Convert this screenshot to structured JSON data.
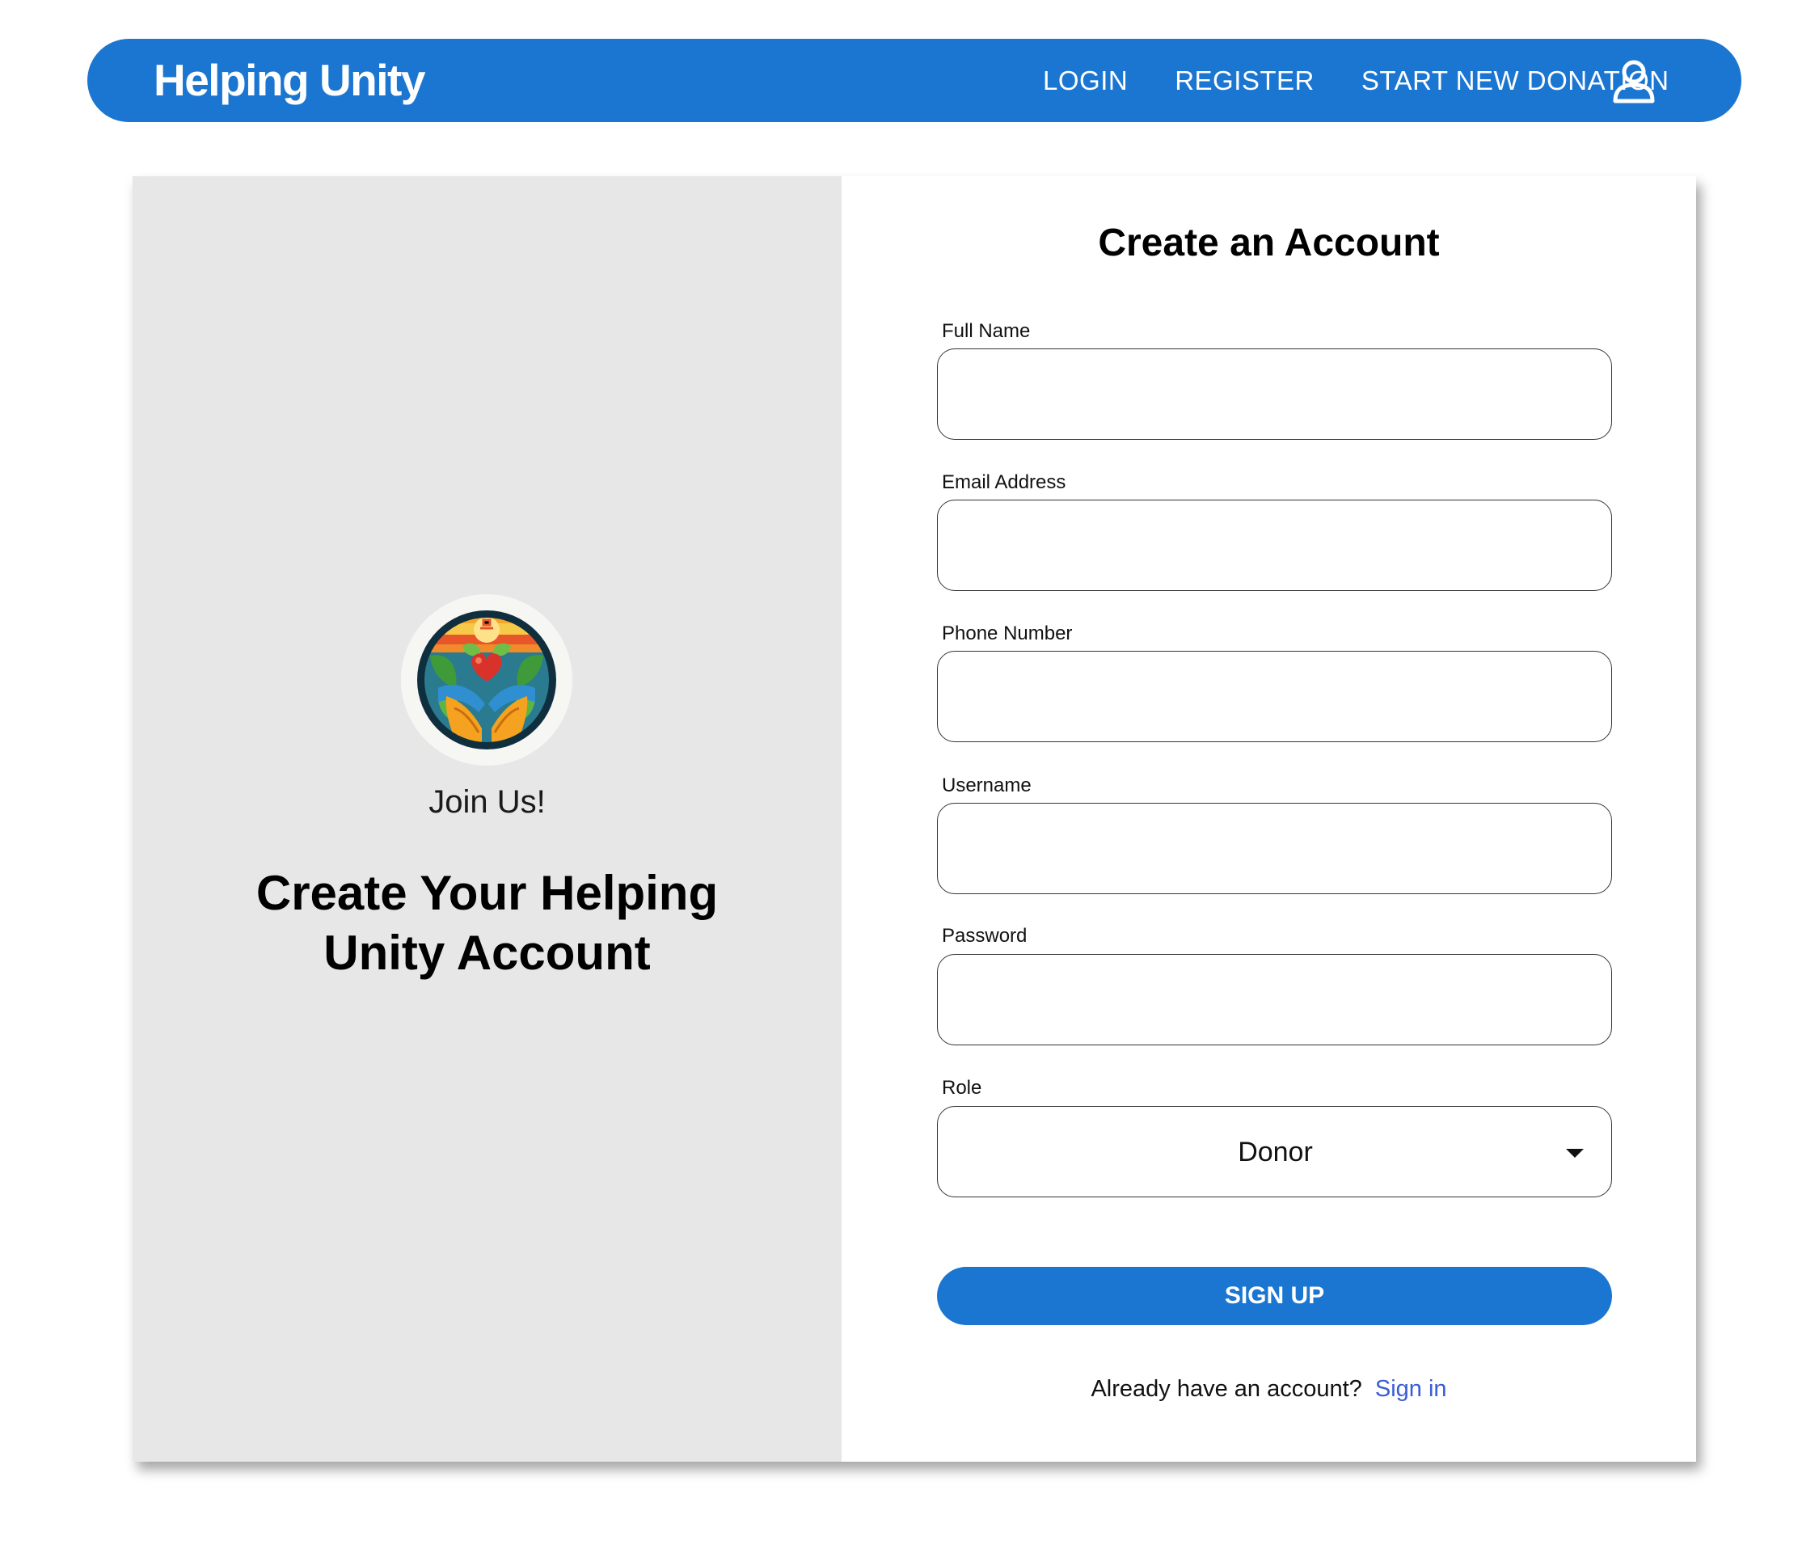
{
  "navbar": {
    "brand": "Helping Unity",
    "links": [
      "LOGIN",
      "REGISTER",
      "START NEW DONATION"
    ],
    "user_icon": "user-icon",
    "color": "#1b76d2"
  },
  "left_panel": {
    "logo_icon": "helping-hands-logo",
    "join_text": "Join Us!",
    "title": "Create Your Helping Unity Account",
    "background": "#e7e7e7"
  },
  "form": {
    "title": "Create an Account",
    "fields": [
      {
        "label": "Full Name",
        "value": ""
      },
      {
        "label": "Email Address",
        "value": ""
      },
      {
        "label": "Phone Number",
        "value": ""
      },
      {
        "label": "Username",
        "value": ""
      },
      {
        "label": "Password",
        "value": ""
      }
    ],
    "role": {
      "label": "Role",
      "selected": "Donor",
      "icon": "caret-down-icon"
    },
    "submit_label": "SIGN UP",
    "signin_prompt": "Already have an account?",
    "signin_link": "Sign in",
    "link_color": "#3a5dd8"
  }
}
